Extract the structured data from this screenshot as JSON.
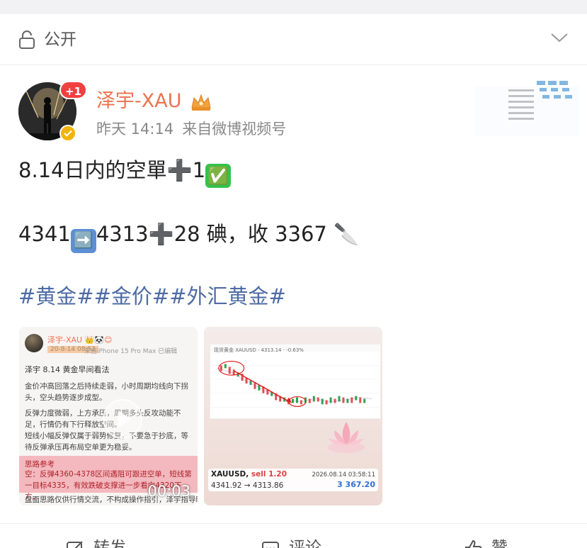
{
  "privacy": {
    "label": "公开"
  },
  "author": {
    "name": "泽宇-XAU",
    "badge_count": "+1",
    "time": "昨天 14:14",
    "source": "来自微博视频号"
  },
  "post": {
    "line1": {
      "text": "8.14日内的空單",
      "plus": "➕",
      "count": "1",
      "check": "✅"
    },
    "line2": {
      "from": "4341",
      "arrow": "➡️",
      "to": "4313",
      "plus": "➕",
      "rest": "28 碘，收 3367",
      "knife": "🔪"
    },
    "hashtags": [
      "#黄金#",
      "#金价#",
      "#外汇黄金#"
    ]
  },
  "video_thumb": {
    "author_name": "泽宇-XAU 👑🐼😊",
    "time": "20-8-14 08:52",
    "device": "来自iPhone 15 Pro Max  已编辑",
    "title": "泽宇 8.14 黄金早间看法",
    "p1": "金价冲高回落之后持续走弱，小时周期均线向下拐头，空头趋势逐步成型。",
    "p2": "反弹力度微弱，上方承压，周期多头反攻动能不足，行情仍有下行释放空间。",
    "p3": "短线小幅反弹仅属于弱势修复，不要急于抄底，等待反弹承压再布局空单更为稳妥。",
    "plan_title": "思路参考",
    "plan_text": "空：反弹4360-4378区间遇阻可跟进空单，短线第一目标4335，有效跌破支撑进一步看向4320下方。",
    "footer": "盘面思路仅供行情交流，不构成操作指引，泽宇指导时",
    "duration": "00:03"
  },
  "image_thumb": {
    "chart_header": "现货黄金  XAUUSD   ·   4313.14   ·   -0.63%",
    "pair": "XAUUSD,",
    "side": "sell 1.20",
    "timestamp": "2026.08.14 03:58:11",
    "prices": "4341.92 → 4313.86",
    "profit": "3 367.20"
  },
  "actions": {
    "repost": "转发",
    "comment": "评论",
    "like": "赞"
  },
  "colors": {
    "username": "#eb7350",
    "hashtag": "#4e6ba5",
    "badge": "#f04040"
  }
}
